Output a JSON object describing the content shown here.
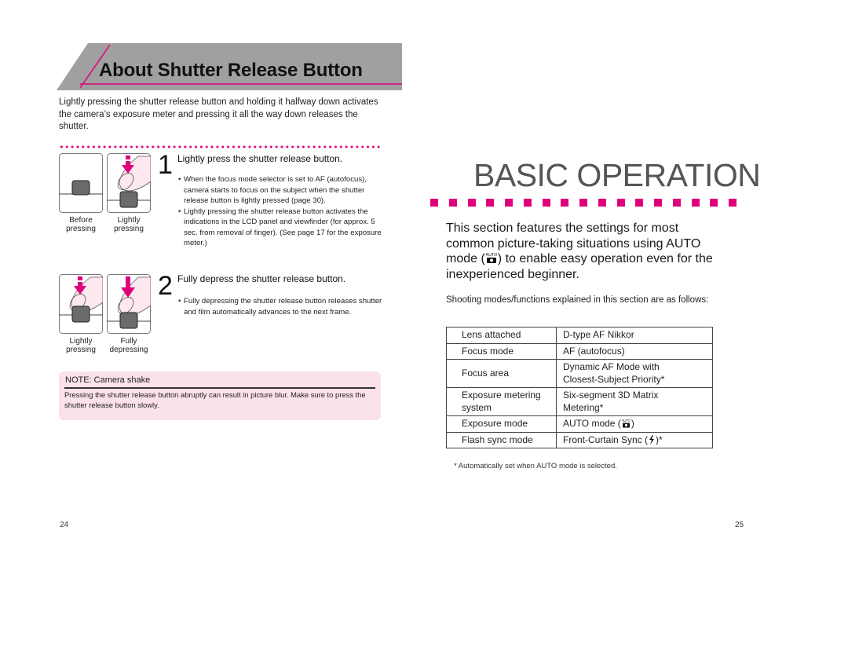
{
  "left_page": {
    "section_title": "About Shutter Release Button",
    "intro": "Lightly pressing the shutter release button and holding it halfway down activates the camera’s exposure meter and pressing it all the way down releases the shutter.",
    "steps": [
      {
        "number": "1",
        "title": "Lightly press the shutter release button.",
        "figures": [
          {
            "caption_line1": "Before",
            "caption_line2": "pressing"
          },
          {
            "caption_line1": "Lightly",
            "caption_line2": "pressing"
          }
        ],
        "bullets": [
          "When the focus mode selector is set to AF (autofocus), camera starts to focus on the subject when the shutter release button is lightly pressed (page 30).",
          "Lightly pressing the shutter release button activates the indications in the LCD panel and viewfinder (for approx. 5 sec. from removal of finger). (See page 17 for the exposure meter.)"
        ]
      },
      {
        "number": "2",
        "title": "Fully depress the shutter release button.",
        "figures": [
          {
            "caption_line1": "Lightly",
            "caption_line2": "pressing"
          },
          {
            "caption_line1": "Fully",
            "caption_line2": "depressing"
          }
        ],
        "bullets": [
          "Fully depressing the shutter release button releases shutter and film automatically advances to the next frame."
        ]
      }
    ],
    "note": {
      "title": "NOTE: Camera shake",
      "body": "Pressing the shutter release button abruptly can result in picture blur. Make sure to press the shutter release button slowly."
    },
    "page_number": "24"
  },
  "right_page": {
    "chapter_title": "BASIC OPERATION",
    "intro_before_icon": "This section features the settings for most common picture-taking situations using AUTO mode (",
    "intro_after_icon": ") to enable easy operation even for the inexperienced beginner.",
    "auto_icon_label": "AUTO",
    "sub_intro": "Shooting modes/functions explained in this section are as follows:",
    "table": [
      {
        "label": "Lens attached",
        "value": "D-type AF Nikkor"
      },
      {
        "label": "Focus mode",
        "value": "AF (autofocus)"
      },
      {
        "label": "Focus area",
        "value_line1": "Dynamic AF Mode with",
        "value_line2": "Closest-Subject Priority*"
      },
      {
        "label_line1": "Exposure metering",
        "label_line2": "system",
        "value_line1": "Six-segment 3D Matrix",
        "value_line2": "Metering*"
      },
      {
        "label": "Exposure mode",
        "value_before_icon": "AUTO mode (",
        "value_after_icon": ")"
      },
      {
        "label": "Flash sync mode",
        "value_before_icon": "Front-Curtain Sync (",
        "flash_icon": "ϟ",
        "value_after_icon": ")*"
      }
    ],
    "footnote": "* Automatically set when AUTO mode is selected.",
    "page_number": "25"
  },
  "colors": {
    "accent_magenta": "#e0007a",
    "banner_gray": "#a0a0a0",
    "note_background": "#fbe1e8",
    "title_gray": "#555555"
  }
}
